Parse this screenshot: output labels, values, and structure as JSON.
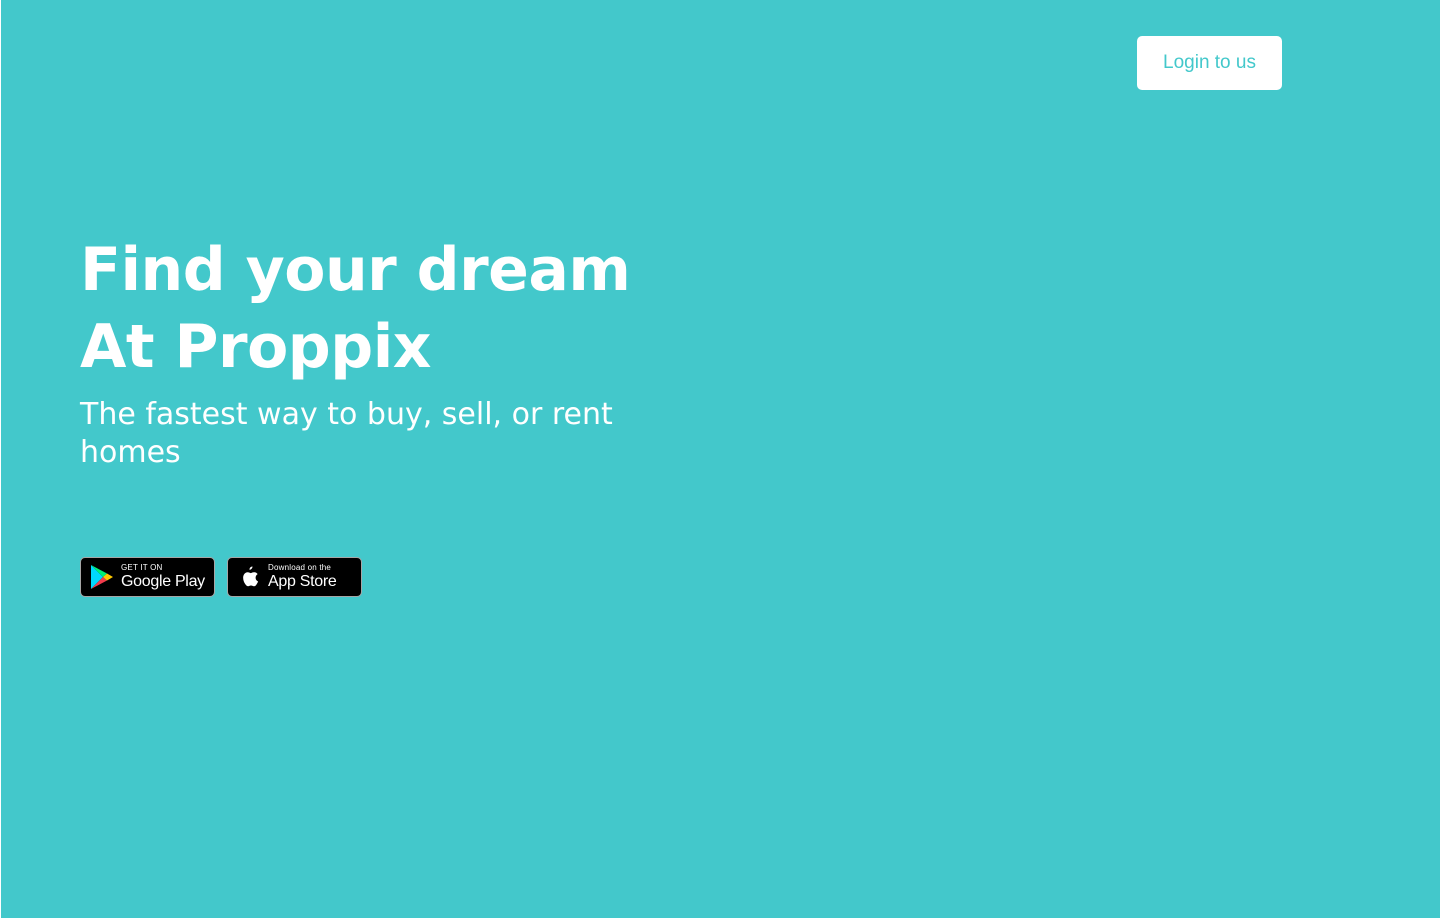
{
  "header": {
    "login_label": "Login to us"
  },
  "hero": {
    "title_line1": "Find your dream",
    "title_line2": "At Proppix",
    "subtitle": "The fastest way to buy, sell, or rent homes"
  },
  "badges": {
    "google_play": {
      "small_text": "GET IT ON",
      "large_text": "Google Play",
      "icon": "google-play-icon"
    },
    "app_store": {
      "small_text": "Download on the",
      "large_text": "App Store",
      "icon": "apple-icon"
    }
  },
  "colors": {
    "background": "#43c8cb",
    "button_background": "#ffffff",
    "button_text": "#43c8cb",
    "hero_text": "#ffffff",
    "badge_background": "#000000"
  }
}
